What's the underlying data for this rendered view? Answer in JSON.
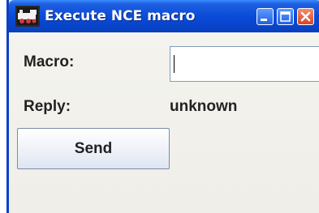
{
  "window": {
    "title": "Execute NCE macro",
    "app_icon": "locomotive-icon",
    "controls": [
      "minimize-icon",
      "maximize-icon",
      "close-icon"
    ]
  },
  "form": {
    "macro_label": "Macro:",
    "macro_value": "",
    "reply_label": "Reply:",
    "reply_value": "unknown",
    "send_label": "Send"
  },
  "colors": {
    "titlebar": "#0a4bd8",
    "close_button": "#d6452a",
    "background": "#ece9d8"
  }
}
